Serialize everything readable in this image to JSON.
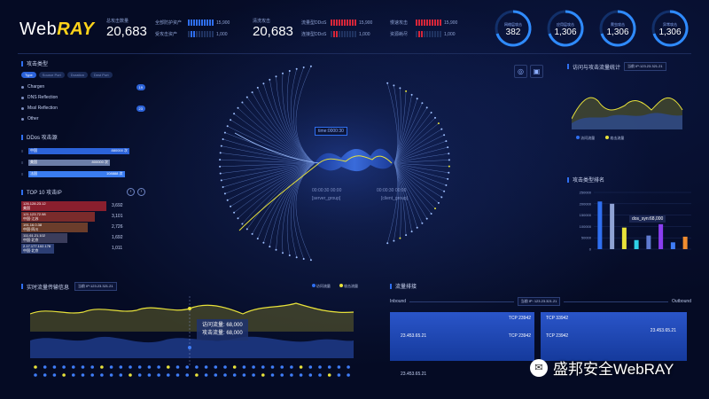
{
  "logo": {
    "prefix": "Web",
    "suffix": "RAY"
  },
  "top_stats": {
    "total_alerts": {
      "label": "总攻击数量",
      "value": "20,683"
    },
    "total_protect": {
      "label": "清洗攻击",
      "value": "20,683"
    },
    "rows_left": [
      {
        "label": "全部防护资产",
        "value": "15,900"
      },
      {
        "label": "受攻击资产",
        "value": "1,000"
      }
    ],
    "rows_right": [
      {
        "label": "流量型DDoS",
        "value": "15,900"
      },
      {
        "label": "连接型DDoS",
        "value": "1,000"
      }
    ],
    "rows_right2": [
      {
        "label": "慢速攻击",
        "value": "15,900"
      },
      {
        "label": "资源耗尽",
        "value": "1,000"
      }
    ]
  },
  "gauges": [
    {
      "label": "网络层攻击",
      "value": "382"
    },
    {
      "label": "应用层攻击",
      "value": "1,306"
    },
    {
      "label": "爬虫攻击",
      "value": "1,306"
    },
    {
      "label": "异常攻击",
      "value": "1,306"
    }
  ],
  "attack_type": {
    "title": "攻击类型",
    "tabs": [
      "Type",
      "Source Port",
      "Duration",
      "Dest Port"
    ],
    "items": [
      {
        "label": "Chargen",
        "count": "19"
      },
      {
        "label": "DNS Reflection",
        "count": ""
      },
      {
        "label": "Mssl Reflection",
        "count": "23"
      },
      {
        "label": "Other",
        "count": ""
      }
    ]
  },
  "ddos_source": {
    "title": "DDos 攻击源",
    "rows": [
      {
        "name": "中国",
        "value": "880000 次",
        "fill": 1.0,
        "color": "#2c63d9"
      },
      {
        "name": "美国",
        "value": "800000 次",
        "fill": 0.8,
        "color": "#6c7ea8"
      },
      {
        "name": "法国",
        "value": "108888 次",
        "fill": 0.95,
        "color": "#3a7cf0"
      }
    ]
  },
  "top10": {
    "title": "TOP 10 攻击IP",
    "rows": [
      {
        "ip": "126.128.23.12",
        "loc": "美国",
        "value": "3,692",
        "fill": 1.0,
        "color": "#8a1f2e"
      },
      {
        "ip": "121.123.72.98",
        "loc": "中国·江苏",
        "value": "3,101",
        "fill": 0.84,
        "color": "#7a2b2b"
      },
      {
        "ip": "191.16.0.38",
        "loc": "中国·四川",
        "value": "2,726",
        "fill": 0.74,
        "color": "#6b3d2b"
      },
      {
        "ip": "111.61.21.102",
        "loc": "中国·北京",
        "value": "1,692",
        "fill": 0.46,
        "color": "#3b3d5c"
      },
      {
        "ip": "2.17.177.102.178",
        "loc": "中国·北京",
        "value": "1,011",
        "fill": 0.28,
        "color": "#2c3e74"
      }
    ]
  },
  "center": {
    "time_label": "time:0000:30",
    "left_caption": "[server_group]",
    "right_caption": "[client_group]",
    "left_num": "00:00:30 00:00",
    "right_num": "00:00:30 00:00"
  },
  "visit_stats": {
    "title": "访问与攻击流量统计",
    "host": "当前 IP:123.23.321.21",
    "legend": [
      "访问流量",
      "攻击流量"
    ]
  },
  "attack_rank": {
    "title": "攻击类型排名",
    "tooltip": "dos_syn:68,000"
  },
  "realtime": {
    "title": "实时流量传输信息",
    "host": "当前 IP:123.23.321.21",
    "legend": [
      "访问流量",
      "攻击流量"
    ],
    "tooltip": {
      "visit": "访问流量: 68,000",
      "attack": "攻击流量: 68,000"
    }
  },
  "traffic": {
    "title": "流量排接",
    "host": "当前 IP: 123.23.321.21",
    "inbound": "Inbound",
    "outbound": "Outbound",
    "left_ip": "23.453.65.21",
    "right_ip": "23.453.65.21",
    "tcp": [
      "TCP 23942",
      "TCP 23942",
      "TCP 33942",
      "TCP 23942"
    ],
    "bottom_ip": "23.453.65.21"
  },
  "watermark": "盛邦安全WebRAY",
  "chart_data": [
    {
      "type": "bar",
      "categories": [
        "",
        "",
        "",
        "",
        "",
        "",
        "",
        ""
      ],
      "values": [
        210000,
        200000,
        95000,
        40000,
        60000,
        110000,
        30000,
        55000
      ],
      "ylim": [
        0,
        250000
      ],
      "yticks": [
        "250000",
        "200000",
        "150000",
        "100000",
        "50000",
        "0"
      ]
    }
  ],
  "colors": {
    "accent": "#2f6ff0",
    "yellow": "#e8e23a",
    "red": "#d6263a"
  }
}
